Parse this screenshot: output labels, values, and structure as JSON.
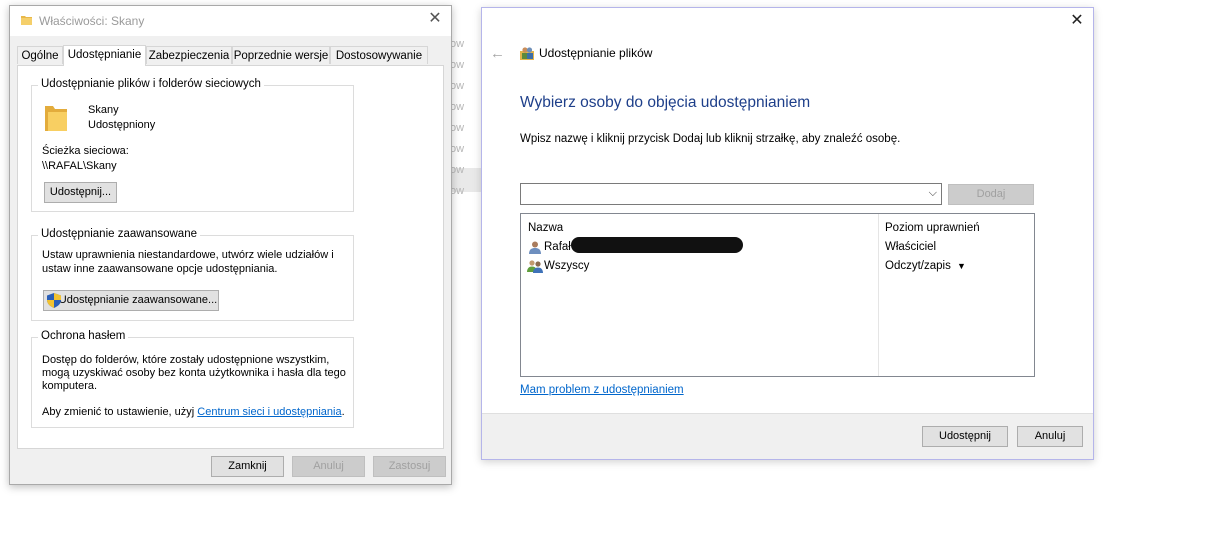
{
  "background": {
    "fragments": [
      "ow",
      "ow",
      "ow",
      "ow",
      "ow",
      "ow",
      "ow",
      "ow"
    ]
  },
  "properties": {
    "title": "Właściwości: Skany",
    "tabs": [
      "Ogólne",
      "Udostępnianie",
      "Zabezpieczenia",
      "Poprzednie wersje",
      "Dostosowywanie"
    ],
    "active_tab": "Udostępnianie",
    "network_group": {
      "legend": "Udostępnianie plików i folderów sieciowych",
      "name": "Skany",
      "state": "Udostępniony",
      "path_label": "Ścieżka sieciowa:",
      "path": "\\\\RAFAL\\Skany",
      "share_button": "Udostępnij..."
    },
    "advanced_group": {
      "legend": "Udostępnianie zaawansowane",
      "desc_line1": "Ustaw uprawnienia niestandardowe, utwórz wiele udziałów i",
      "desc_line2": "ustaw inne zaawansowane opcje udostępniania.",
      "button": "Udostępnianie zaawansowane..."
    },
    "password_group": {
      "legend": "Ochrona hasłem",
      "desc_line1": "Dostęp do folderów, które zostały udostępnione wszystkim,",
      "desc_line2": "mogą uzyskiwać osoby bez konta użytkownika i hasła dla tego",
      "desc_line3": "komputera.",
      "change_prefix": "Aby zmienić to ustawienie, użyj ",
      "change_link": "Centrum sieci i udostępniania",
      "change_suffix": "."
    },
    "buttons": {
      "close": "Zamknij",
      "cancel": "Anuluj",
      "apply": "Zastosuj"
    }
  },
  "sharing": {
    "header": "Udostępnianie plików",
    "heading": "Wybierz osoby do objęcia udostępnianiem",
    "instruction": "Wpisz nazwę i kliknij przycisk Dodaj lub kliknij strzałkę, aby znaleźć osobę.",
    "input_value": "",
    "add_button": "Dodaj",
    "columns": {
      "name": "Nazwa",
      "permission": "Poziom uprawnień"
    },
    "rows": [
      {
        "name": "Rafał",
        "permission": "Właściciel"
      },
      {
        "name": "Wszyscy",
        "permission": "Odczyt/zapis"
      }
    ],
    "help_link": "Mam problem z udostępnianiem",
    "share_button": "Udostępnij",
    "cancel_button": "Anuluj"
  },
  "icons": {
    "folder": "folder-icon",
    "shield": "uac-shield-icon",
    "user": "user-icon",
    "group": "users-group-icon"
  }
}
